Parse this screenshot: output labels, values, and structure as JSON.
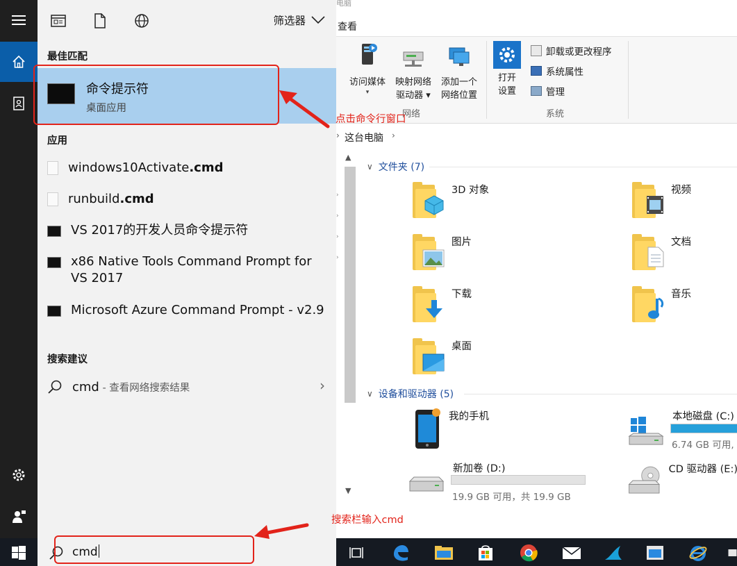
{
  "explorer": {
    "title_fragment": "电脑",
    "ribbon_tab": "查看",
    "ribbon": {
      "access_media": {
        "line1": "访问媒体",
        "line2": "▾"
      },
      "map_drive": {
        "line1": "映射网络",
        "line2": "驱动器 ▾"
      },
      "add_network": {
        "line1": "添加一个",
        "line2": "网络位置"
      },
      "network_group": "网络",
      "open_settings": {
        "line1": "打开",
        "line2": "设置"
      },
      "uninstall": "卸载或更改程序",
      "system_properties": "系统属性",
      "manage": "管理",
      "system_group": "系统"
    },
    "address": {
      "crumb": "这台电脑",
      "arrow": "›"
    },
    "folders_header": "文件夹 (7)",
    "folders": [
      {
        "name": "3D 对象",
        "icon": "3d-objects-icon"
      },
      {
        "name": "视频",
        "icon": "videos-icon"
      },
      {
        "name": "图片",
        "icon": "pictures-icon"
      },
      {
        "name": "文档",
        "icon": "documents-icon"
      },
      {
        "name": "下载",
        "icon": "downloads-icon"
      },
      {
        "name": "音乐",
        "icon": "music-icon"
      },
      {
        "name": "桌面",
        "icon": "desktop-icon"
      }
    ],
    "devices_header": "设备和驱动器 (5)",
    "devices": {
      "phone": "我的手机",
      "c_drive": {
        "name": "本地磁盘 (C:)",
        "detail": "6.74 GB 可用,",
        "used_fraction": 1.0
      },
      "d_drive": {
        "name": "新加卷 (D:)",
        "detail": "19.9 GB 可用，共 19.9 GB",
        "used_fraction": 0.0
      },
      "e_drive": {
        "name": "CD 驱动器 (E:)"
      }
    }
  },
  "search_panel": {
    "filter_label": "筛选器",
    "best_match_title": "最佳匹配",
    "best_match": {
      "name": "命令提示符",
      "subtitle": "桌面应用"
    },
    "apps_title": "应用",
    "apps": [
      {
        "prefix": "windows10Activate",
        "ext": ".cmd"
      },
      {
        "prefix": "runbuild",
        "ext": ".cmd"
      },
      {
        "label": "VS 2017的开发人员命令提示符"
      },
      {
        "label": "x86 Native Tools Command Prompt for VS 2017"
      },
      {
        "label": "Microsoft Azure Command Prompt - v2.9"
      }
    ],
    "suggestions_title": "搜索建议",
    "suggestion": {
      "query": "cmd",
      "hint": " - 查看网络搜索结果"
    }
  },
  "taskbar": {
    "search_query": "cmd"
  },
  "annotations": {
    "click_cmd": "点击命令行窗口",
    "type_cmd": "搜索栏输入cmd"
  },
  "colors": {
    "accent": "#0b5ea9",
    "selection": "#a9cfee",
    "annotation": "#e2231a",
    "link": "#1f4e9c"
  }
}
